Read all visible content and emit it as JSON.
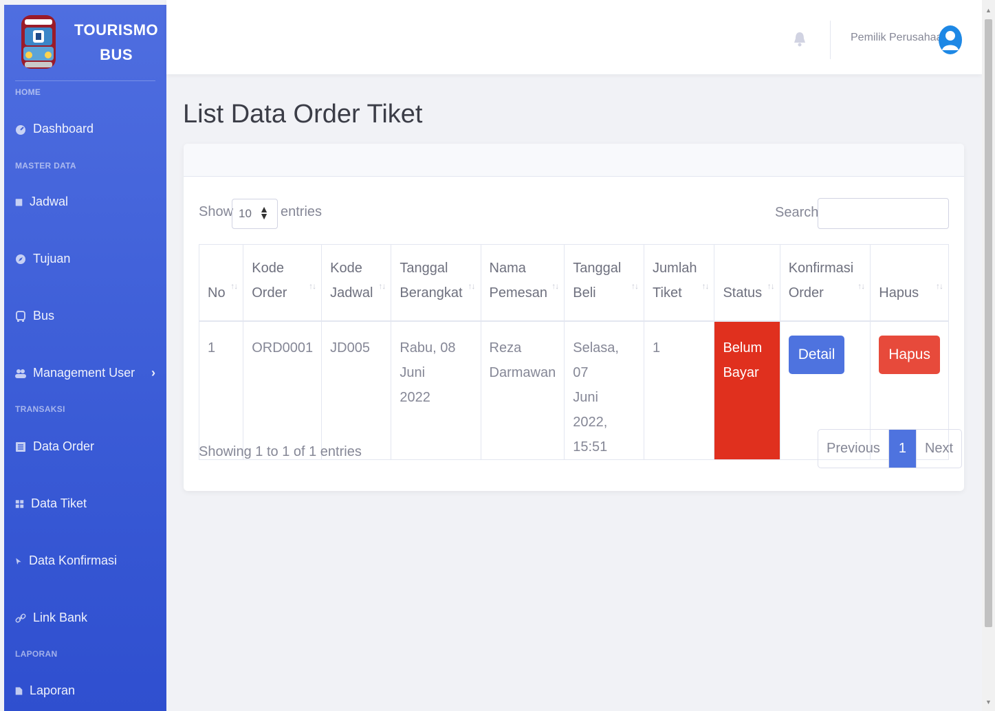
{
  "brand": {
    "line1": "TOURISMO",
    "line2": "BUS"
  },
  "sidebar": {
    "headings": {
      "home": "HOME",
      "master": "MASTER DATA",
      "transaksi": "TRANSAKSI",
      "laporan": "LAPORAN"
    },
    "items": [
      {
        "label": "Dashboard",
        "icon": "dashboard-icon"
      },
      {
        "label": "Jadwal",
        "icon": "clipboard-icon"
      },
      {
        "label": "Tujuan",
        "icon": "compass-icon"
      },
      {
        "label": "Bus",
        "icon": "bus-icon"
      },
      {
        "label": "Management User",
        "icon": "users-icon",
        "chevron": "›"
      },
      {
        "label": "Data Order",
        "icon": "list-icon"
      },
      {
        "label": "Data Tiket",
        "icon": "grid-icon"
      },
      {
        "label": "Data Konfirmasi",
        "icon": "pointer-icon"
      },
      {
        "label": "Link Bank",
        "icon": "link-icon"
      },
      {
        "label": "Laporan",
        "icon": "file-icon"
      }
    ]
  },
  "topbar": {
    "user_name": "Pemilik Perusahaan"
  },
  "page": {
    "title": "List Data Order Tiket"
  },
  "table_controls": {
    "show": "Show",
    "length_value": "10",
    "entries": "entries",
    "search_label": "Search:",
    "search_value": ""
  },
  "table": {
    "headers": [
      [
        "No"
      ],
      [
        "Kode",
        "Order"
      ],
      [
        "Kode",
        "Jadwal"
      ],
      [
        "Tanggal",
        "Berangkat"
      ],
      [
        "Nama",
        "Pemesan"
      ],
      [
        "Tanggal",
        "Beli"
      ],
      [
        "Jumlah",
        "Tiket"
      ],
      [
        "Status"
      ],
      [
        "Konfirmasi",
        "Order"
      ],
      [
        "Hapus"
      ]
    ],
    "rows": [
      {
        "no": "1",
        "kode_order": "ORD0001",
        "kode_jadwal": "JD005",
        "tanggal_berangkat": [
          "Rabu, 08 Juni",
          "2022"
        ],
        "nama_pemesan": [
          "Reza",
          "Darmawan"
        ],
        "tanggal_beli": [
          "Selasa, 07",
          "Juni 2022,",
          "15:51"
        ],
        "jumlah_tiket": "1",
        "status": [
          "Belum",
          "Bayar"
        ],
        "status_color": "#e0301e",
        "detail_label": "Detail",
        "hapus_label": "Hapus"
      }
    ]
  },
  "footer_info": "Showing 1 to 1 of 1 entries",
  "pagination": {
    "previous": "Previous",
    "current": "1",
    "next": "Next"
  },
  "colors": {
    "sidebar_start": "#4f6ee0",
    "sidebar_end": "#2f4fcf",
    "primary": "#4e73df",
    "danger": "#e74a3b"
  }
}
